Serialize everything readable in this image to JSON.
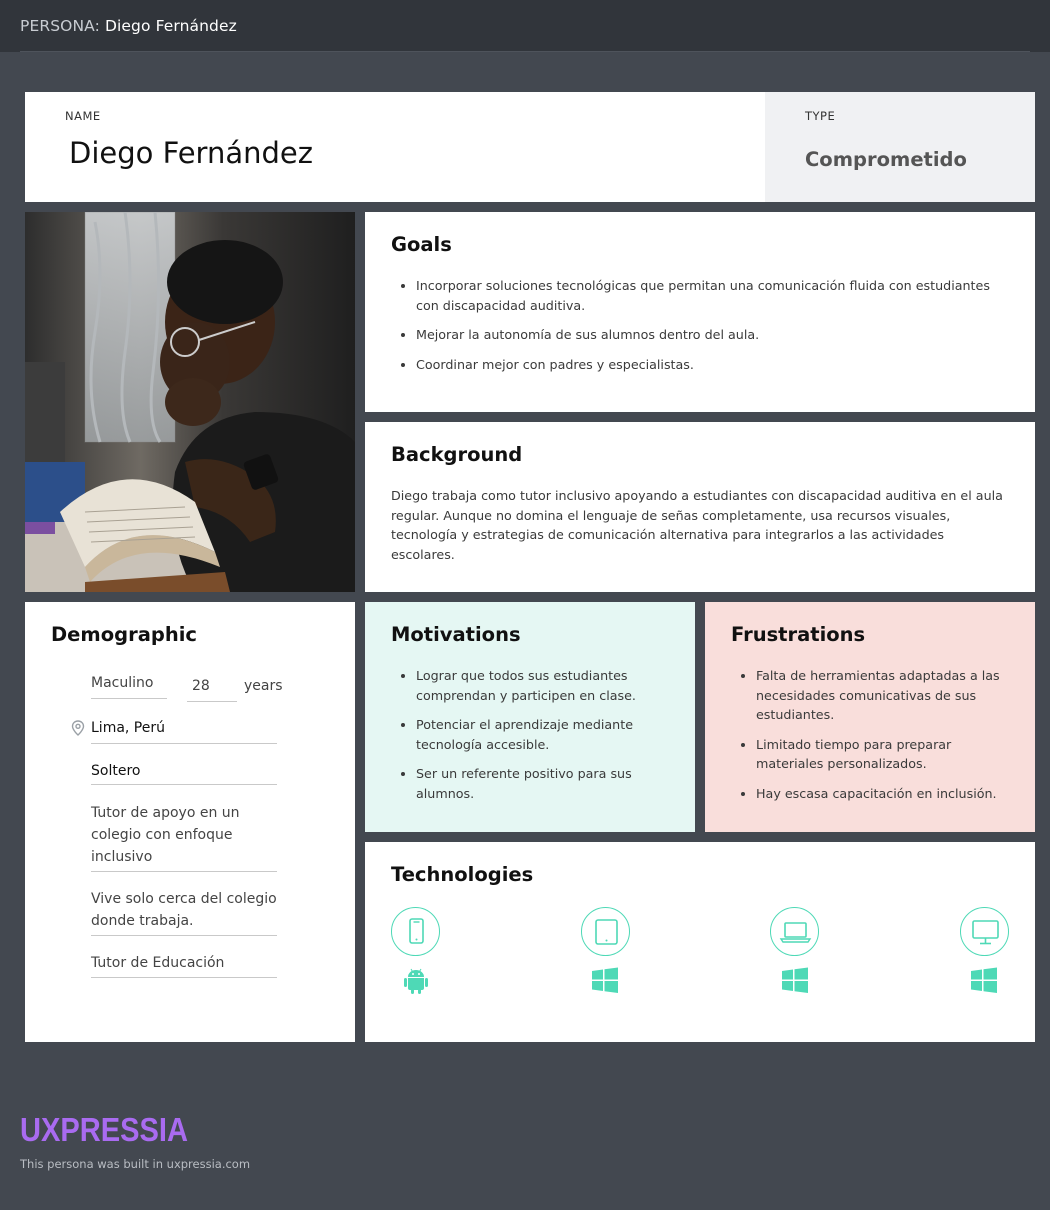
{
  "header": {
    "prefix": "PERSONA: ",
    "persona_name": "Diego Fernández"
  },
  "name_card": {
    "label": "NAME",
    "value": "Diego Fernández"
  },
  "type_card": {
    "label": "TYPE",
    "value": "Comprometido"
  },
  "goals": {
    "title": "Goals",
    "items": [
      "Incorporar soluciones tecnológicas que permitan una comunicación fluida con estudiantes con discapacidad auditiva.",
      "Mejorar la autonomía de sus alumnos dentro del aula.",
      "Coordinar mejor con padres y especialistas."
    ]
  },
  "background": {
    "title": "Background",
    "text": "Diego trabaja como tutor inclusivo apoyando a estudiantes con discapacidad auditiva en el aula regular. Aunque no domina el lenguaje de señas completamente, usa recursos visuales, tecnología y estrategias de comunicación alternativa para integrarlos a las actividades escolares."
  },
  "demographic": {
    "title": "Demographic",
    "gender": "Maculino",
    "age": "28",
    "age_unit": "years",
    "location": "Lima, Perú",
    "status": "Soltero",
    "occupation": "Tutor de apoyo en un colegio con enfoque inclusivo",
    "living": "Vive solo cerca del colegio donde trabaja.",
    "role": "Tutor de Educación"
  },
  "motivations": {
    "title": "Motivations",
    "items": [
      "Lograr que todos sus estudiantes comprendan y participen en clase.",
      "Potenciar el aprendizaje mediante tecnología accesible.",
      "Ser un referente positivo para sus alumnos."
    ]
  },
  "frustrations": {
    "title": "Frustrations",
    "items": [
      "Falta de herramientas adaptadas a las necesidades comunicativas de sus estudiantes.",
      "Limitado tiempo para preparar materiales personalizados.",
      "Hay escasa capacitación en inclusión."
    ]
  },
  "technologies": {
    "title": "Technologies",
    "devices": [
      {
        "device": "smartphone-icon",
        "os": "android-icon"
      },
      {
        "device": "tablet-icon",
        "os": "windows-icon"
      },
      {
        "device": "laptop-icon",
        "os": "windows-icon"
      },
      {
        "device": "desktop-icon",
        "os": "windows-icon"
      }
    ],
    "accent": "#4ed9b6"
  },
  "footer": {
    "logo": "UXPRESSIA",
    "note": "This persona was built in uxpressia.com",
    "logo_color": "#a96bf0"
  },
  "colors": {
    "page_bg": "#434850",
    "topbar_bg": "#31353b",
    "motivations_bg": "#e5f7f3",
    "frustrations_bg": "#f9dedb"
  }
}
